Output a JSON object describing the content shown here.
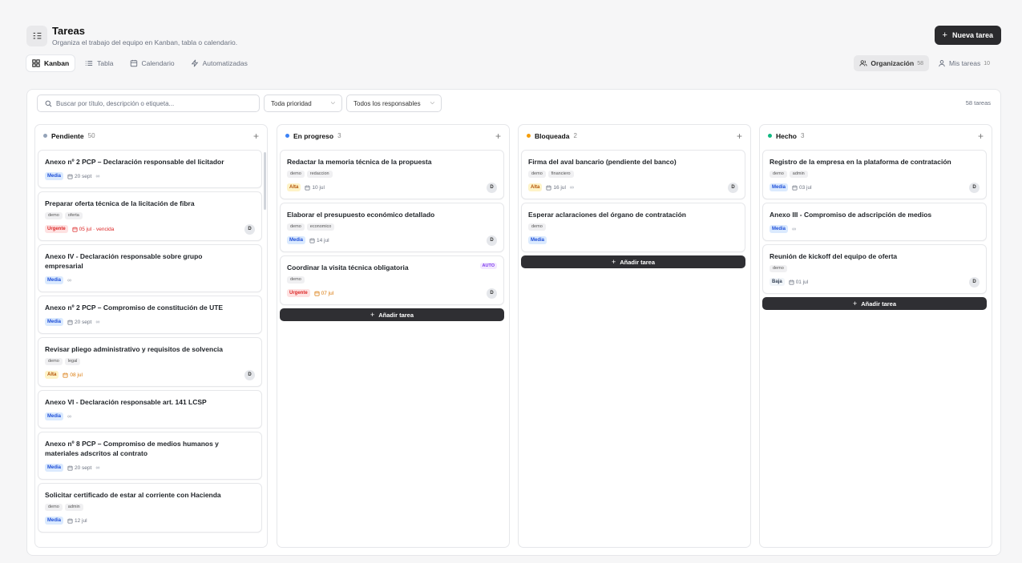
{
  "header": {
    "title": "Tareas",
    "subtitle": "Organiza el trabajo del equipo en Kanban, tabla o calendario.",
    "new_task_label": "Nueva tarea"
  },
  "view_tabs": [
    {
      "label": "Kanban",
      "icon": "kanban-icon",
      "active": true
    },
    {
      "label": "Tabla",
      "icon": "list-icon",
      "active": false
    },
    {
      "label": "Calendario",
      "icon": "calendar-icon",
      "active": false
    },
    {
      "label": "Automatizadas",
      "icon": "bolt-icon",
      "active": false
    }
  ],
  "scope_tabs": [
    {
      "label": "Organización",
      "count": "58",
      "icon": "users-icon",
      "active": true
    },
    {
      "label": "Mis tareas",
      "count": "10",
      "icon": "user-icon",
      "active": false
    }
  ],
  "filters": {
    "search_placeholder": "Buscar por título, descripción o etiqueta...",
    "priority_value": "Toda prioridad",
    "assignee_value": "Todos los responsables",
    "total": "58 tareas"
  },
  "colors": {
    "pendiente": "#94a3b8",
    "en_progreso": "#3b82f6",
    "bloqueada": "#f59e0b",
    "hecho": "#10b981"
  },
  "columns": [
    {
      "title": "Pendiente",
      "count": "50",
      "color": "#94a3b8",
      "cards": [
        {
          "title": "Anexo nº 2 PCP – Declaración responsable del licitador",
          "tags": [],
          "priority": "Media",
          "prio_class": "media",
          "date": "20 sept",
          "date_class": "",
          "link": true,
          "avatar": ""
        },
        {
          "title": "Preparar oferta técnica de la licitación de fibra",
          "tags": [
            "demo",
            "oferta"
          ],
          "priority": "Urgente",
          "prio_class": "urgente",
          "date": "05 jul · vencida",
          "date_class": "overdue",
          "link": false,
          "avatar": "D"
        },
        {
          "title": "Anexo IV - Declaración responsable sobre grupo empresarial",
          "tags": [],
          "priority": "Media",
          "prio_class": "media",
          "date": "",
          "date_class": "",
          "link": true,
          "avatar": ""
        },
        {
          "title": "Anexo nº 2 PCP – Compromiso de constitución de UTE",
          "tags": [],
          "priority": "Media",
          "prio_class": "media",
          "date": "20 sept",
          "date_class": "",
          "link": true,
          "avatar": ""
        },
        {
          "title": "Revisar pliego administrativo y requisitos de solvencia",
          "tags": [
            "demo",
            "legal"
          ],
          "priority": "Alta",
          "prio_class": "alta",
          "date": "08 jul",
          "date_class": "warn",
          "link": false,
          "avatar": "D"
        },
        {
          "title": "Anexo VI - Declaración responsable art. 141 LCSP",
          "tags": [],
          "priority": "Media",
          "prio_class": "media",
          "date": "",
          "date_class": "",
          "link": true,
          "avatar": ""
        },
        {
          "title": "Anexo nº 8 PCP – Compromiso de medios humanos y materiales adscritos al contrato",
          "tags": [],
          "priority": "Media",
          "prio_class": "media",
          "date": "20 sept",
          "date_class": "",
          "link": true,
          "avatar": ""
        },
        {
          "title": "Solicitar certificado de estar al corriente con Hacienda",
          "tags": [
            "demo",
            "admin"
          ],
          "priority": "Media",
          "prio_class": "media",
          "date": "12 jul",
          "date_class": "",
          "link": false,
          "avatar": ""
        }
      ]
    },
    {
      "title": "En progreso",
      "count": "3",
      "color": "#3b82f6",
      "add_label": "Añadir tarea",
      "cards": [
        {
          "title": "Redactar la memoria técnica de la propuesta",
          "tags": [
            "demo",
            "redaccion"
          ],
          "priority": "Alta",
          "prio_class": "alta",
          "date": "10 jul",
          "date_class": "",
          "link": false,
          "avatar": "D"
        },
        {
          "title": "Elaborar el presupuesto económico detallado",
          "tags": [
            "demo",
            "economico"
          ],
          "priority": "Media",
          "prio_class": "media",
          "date": "14 jul",
          "date_class": "",
          "link": false,
          "avatar": "D"
        },
        {
          "title": "Coordinar la visita técnica obligatoria",
          "tags": [
            "demo"
          ],
          "priority": "Urgente",
          "prio_class": "urgente",
          "date": "07 jul",
          "date_class": "warn",
          "link": false,
          "avatar": "D",
          "badge": "AUTO"
        }
      ]
    },
    {
      "title": "Bloqueada",
      "count": "2",
      "color": "#f59e0b",
      "add_label": "Añadir tarea",
      "cards": [
        {
          "title": "Firma del aval bancario (pendiente del banco)",
          "tags": [
            "demo",
            "financiero"
          ],
          "priority": "Alta",
          "prio_class": "alta",
          "date": "16 jul",
          "date_class": "",
          "link": true,
          "avatar": "D"
        },
        {
          "title": "Esperar aclaraciones del órgano de contratación",
          "tags": [
            "demo"
          ],
          "priority": "Media",
          "prio_class": "media",
          "date": "",
          "date_class": "",
          "link": false,
          "avatar": ""
        }
      ]
    },
    {
      "title": "Hecho",
      "count": "3",
      "color": "#10b981",
      "add_label": "Añadir tarea",
      "cards": [
        {
          "title": "Registro de la empresa en la plataforma de contratación",
          "tags": [
            "demo",
            "admin"
          ],
          "priority": "Media",
          "prio_class": "media",
          "date": "03 jul",
          "date_class": "",
          "link": false,
          "avatar": "D"
        },
        {
          "title": "Anexo III - Compromiso de adscripción de medios",
          "tags": [],
          "priority": "Media",
          "prio_class": "media",
          "date": "",
          "date_class": "",
          "link": true,
          "avatar": ""
        },
        {
          "title": "Reunión de kickoff del equipo de oferta",
          "tags": [
            "demo"
          ],
          "priority": "Baja",
          "prio_class": "baja",
          "date": "01 jul",
          "date_class": "",
          "link": false,
          "avatar": "D"
        }
      ]
    }
  ]
}
